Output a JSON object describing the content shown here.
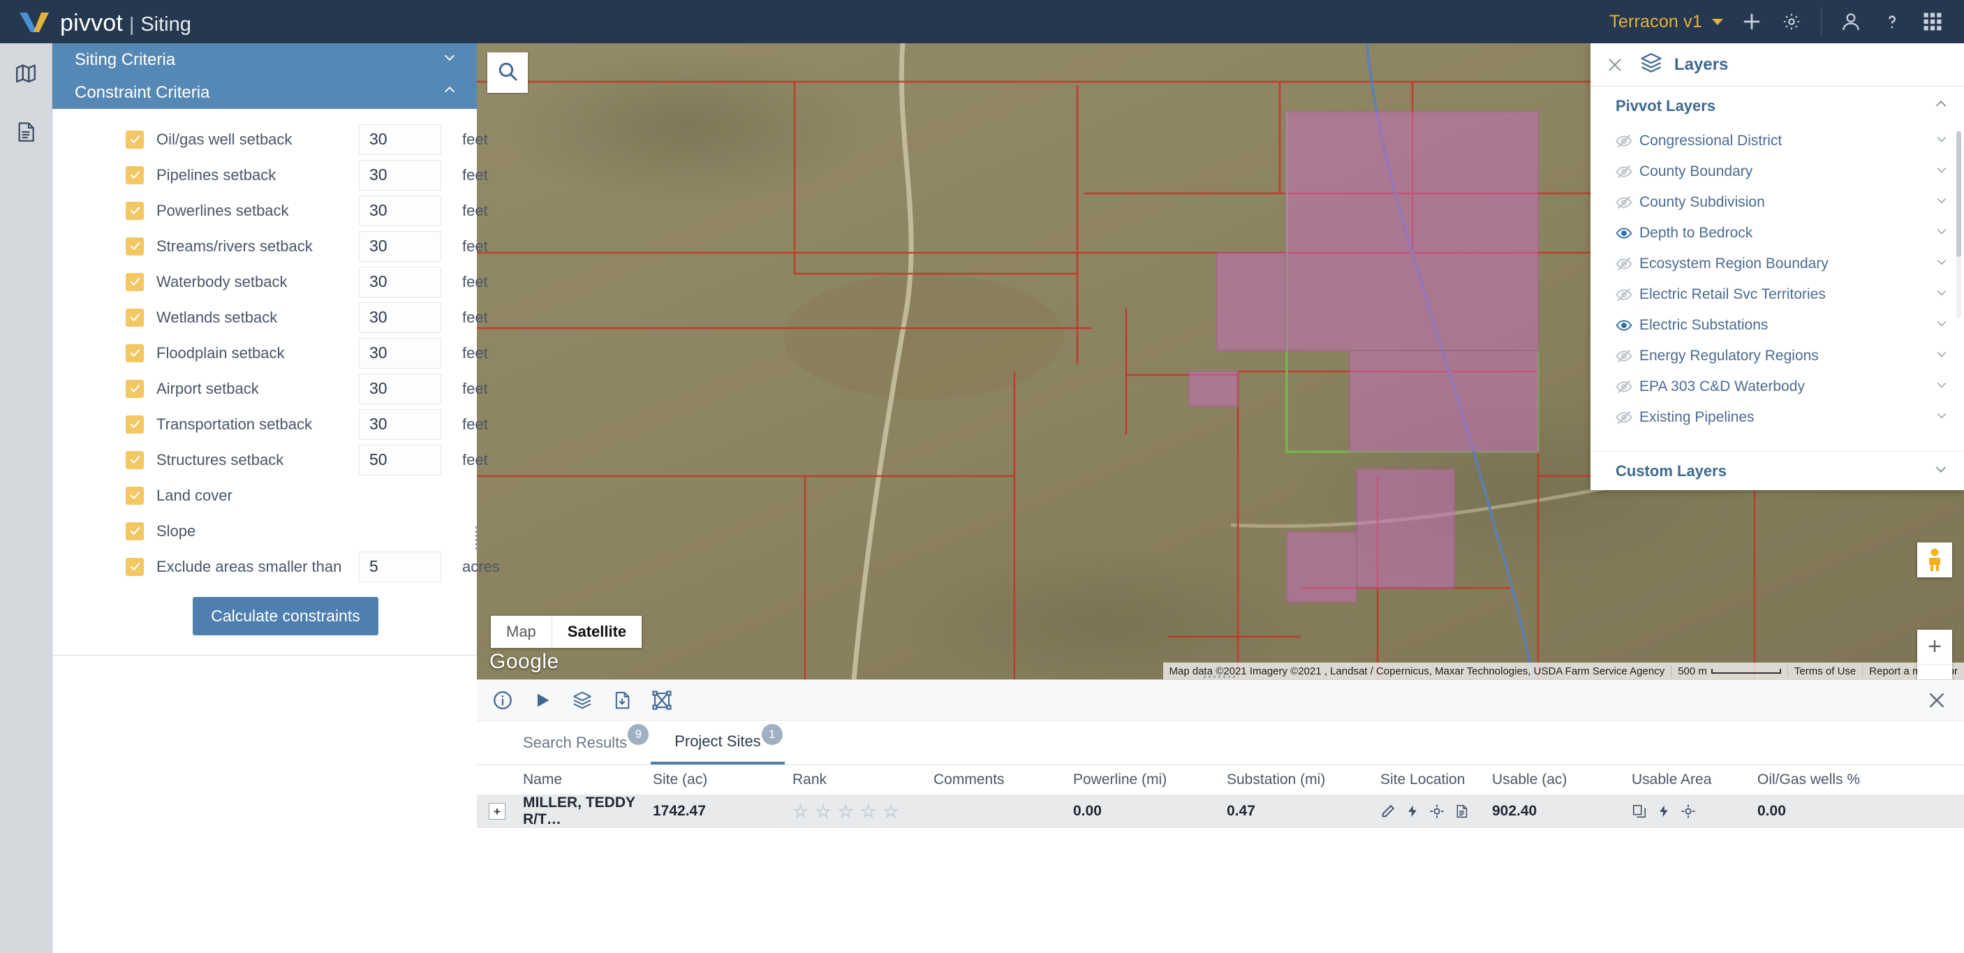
{
  "header": {
    "brand": "pivvot",
    "brand_separator": "|",
    "brand_sub": "Siting",
    "tenant": "Terracon v1",
    "icons": [
      "caret-down-icon",
      "plus-icon",
      "gear-icon",
      "user-icon",
      "help-icon",
      "apps-grid-icon"
    ]
  },
  "rail": {
    "items": [
      {
        "name": "map-icon"
      },
      {
        "name": "document-icon"
      }
    ]
  },
  "criteria_panel": {
    "siting_title": "Siting Criteria",
    "constraint_title": "Constraint Criteria",
    "rows": [
      {
        "label": "Oil/gas well setback",
        "value": "30",
        "unit": "feet",
        "checked": true,
        "gear": false
      },
      {
        "label": "Pipelines setback",
        "value": "30",
        "unit": "feet",
        "checked": true,
        "gear": false
      },
      {
        "label": "Powerlines setback",
        "value": "30",
        "unit": "feet",
        "checked": true,
        "gear": false
      },
      {
        "label": "Streams/rivers setback",
        "value": "30",
        "unit": "feet",
        "checked": true,
        "gear": false
      },
      {
        "label": "Waterbody setback",
        "value": "30",
        "unit": "feet",
        "checked": true,
        "gear": false
      },
      {
        "label": "Wetlands setback",
        "value": "30",
        "unit": "feet",
        "checked": true,
        "gear": false
      },
      {
        "label": "Floodplain setback",
        "value": "30",
        "unit": "feet",
        "checked": true,
        "gear": false
      },
      {
        "label": "Airport setback",
        "value": "30",
        "unit": "feet",
        "checked": true,
        "gear": false
      },
      {
        "label": "Transportation setback",
        "value": "30",
        "unit": "feet",
        "checked": true,
        "gear": false
      },
      {
        "label": "Structures setback",
        "value": "50",
        "unit": "feet",
        "checked": true,
        "gear": false
      },
      {
        "label": "Land cover",
        "value": "",
        "unit": "",
        "checked": true,
        "gear": true
      },
      {
        "label": "Slope",
        "value": "",
        "unit": "",
        "checked": true,
        "gear": true
      },
      {
        "label": "Exclude areas smaller than",
        "value": "5",
        "unit": "acres",
        "checked": true,
        "gear": false
      }
    ],
    "calculate_label": "Calculate constraints"
  },
  "map": {
    "search_icon": "search-icon",
    "maptype": {
      "map": "Map",
      "satellite": "Satellite",
      "active": "Satellite"
    },
    "watermark": "Google",
    "attribution": "Map data ©2021 Imagery ©2021 , Landsat / Copernicus, Maxar Technologies, USDA Farm Service Agency",
    "scale": "500 m",
    "terms": "Terms of Use",
    "report": "Report a map error",
    "zoom_in": "+",
    "zoom_out": "−"
  },
  "layers_panel": {
    "title": "Layers",
    "groups": [
      {
        "title": "Pivvot Layers",
        "expanded": true,
        "items": [
          {
            "label": "Congressional District",
            "visible": false
          },
          {
            "label": "County Boundary",
            "visible": false
          },
          {
            "label": "County Subdivision",
            "visible": false
          },
          {
            "label": "Depth to Bedrock",
            "visible": true
          },
          {
            "label": "Ecosystem Region Boundary",
            "visible": false
          },
          {
            "label": "Electric Retail Svc Territories",
            "visible": false
          },
          {
            "label": "Electric Substations",
            "visible": true
          },
          {
            "label": "Energy Regulatory Regions",
            "visible": false
          },
          {
            "label": "EPA 303 C&D Waterbody",
            "visible": false
          },
          {
            "label": "Existing Pipelines",
            "visible": false
          }
        ]
      },
      {
        "title": "Custom Layers",
        "expanded": false,
        "items": []
      }
    ]
  },
  "dock": {
    "toolbar_icons": [
      "info-icon",
      "play-icon",
      "layers-icon",
      "file-download-icon",
      "site-boundary-icon"
    ],
    "close_icon": "close-icon",
    "tabs": [
      {
        "label": "Search Results",
        "badge": "9",
        "active": false
      },
      {
        "label": "Project Sites",
        "badge": "1",
        "active": true
      }
    ],
    "table": {
      "columns": [
        "Name",
        "Site (ac)",
        "Rank",
        "Comments",
        "Powerline (mi)",
        "Substation (mi)",
        "Site Location",
        "Usable (ac)",
        "Usable Area",
        "Oil/Gas wells %"
      ],
      "rows": [
        {
          "expander": "+",
          "name": "MILLER, TEDDY R/T…",
          "site_ac": "1742.47",
          "rank": 0,
          "comments": "",
          "powerline_mi": "0.00",
          "substation_mi": "0.47",
          "site_location_icons": [
            "pencil-icon",
            "bolt-icon",
            "target-icon",
            "report-icon"
          ],
          "usable_ac": "902.40",
          "usable_area_icons": [
            "copy-icon",
            "bolt-icon",
            "target-icon"
          ],
          "oilgas_pct": "0.00"
        }
      ]
    }
  },
  "colors": {
    "header_bg": "#26384f",
    "accent_gold": "#e3b23c",
    "panel_header": "#5688b5",
    "checkbox": "#f3c762",
    "button_blue": "#4e7fae",
    "layer_text": "#4a6b91"
  }
}
